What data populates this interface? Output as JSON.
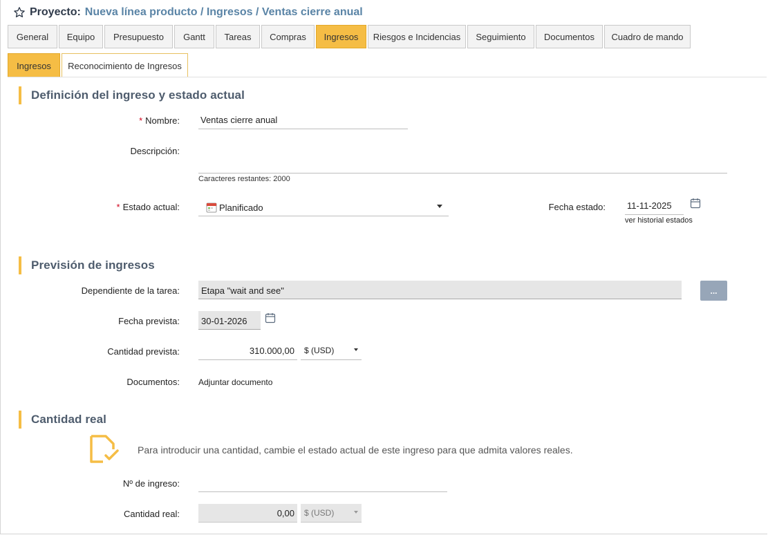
{
  "header": {
    "project_label": "Proyecto:",
    "project_path": "Nueva línea producto / Ingresos / Ventas cierre anual"
  },
  "tabs": [
    {
      "label": "General"
    },
    {
      "label": "Equipo"
    },
    {
      "label": "Presupuesto"
    },
    {
      "label": "Gantt"
    },
    {
      "label": "Tareas"
    },
    {
      "label": "Compras"
    },
    {
      "label": "Ingresos",
      "active": true
    },
    {
      "label": "Riesgos e Incidencias"
    },
    {
      "label": "Seguimiento"
    },
    {
      "label": "Documentos"
    },
    {
      "label": "Cuadro de mando"
    }
  ],
  "subtabs": [
    {
      "label": "Ingresos",
      "active": true
    },
    {
      "label": "Reconocimiento de Ingresos"
    }
  ],
  "definicion": {
    "title": "Definición del ingreso y estado actual",
    "nombre_label": "Nombre:",
    "nombre_value": "Ventas cierre anual",
    "descripcion_label": "Descripción:",
    "caracteres_restantes": "Caracteres restantes: 2000",
    "estado_label": "Estado actual:",
    "estado_value": "Planificado",
    "fecha_estado_label": "Fecha estado:",
    "fecha_estado_value": "11-11-2025",
    "historial_link": "ver historial estados"
  },
  "prevision": {
    "title": "Previsión de ingresos",
    "dependiente_label": "Dependiente de la tarea:",
    "dependiente_value": "Etapa \"wait and see\"",
    "dots_button": "...",
    "fecha_prevista_label": "Fecha prevista:",
    "fecha_prevista_value": "30-01-2026",
    "cantidad_prevista_label": "Cantidad prevista:",
    "cantidad_prevista_value": "310.000,00",
    "moneda_value": "$ (USD)",
    "documentos_label": "Documentos:",
    "adjuntar_link": "Adjuntar documento"
  },
  "real": {
    "title": "Cantidad real",
    "info_text": "Para introducir una cantidad, cambie el estado actual de este ingreso para que admita valores reales.",
    "num_ingreso_label": "Nº de ingreso:",
    "cantidad_real_label": "Cantidad real:",
    "cantidad_real_value": "0,00",
    "moneda_value": "$ (USD)"
  },
  "colors": {
    "accent": "#f5bd45",
    "link_blue": "#5a84a6",
    "required": "#d0021b",
    "button_grey": "#97a6b8"
  },
  "icons": {
    "favorite": "star-icon",
    "calendar": "calendar-icon",
    "status": "calendar-status-icon",
    "info": "document-check-icon"
  }
}
